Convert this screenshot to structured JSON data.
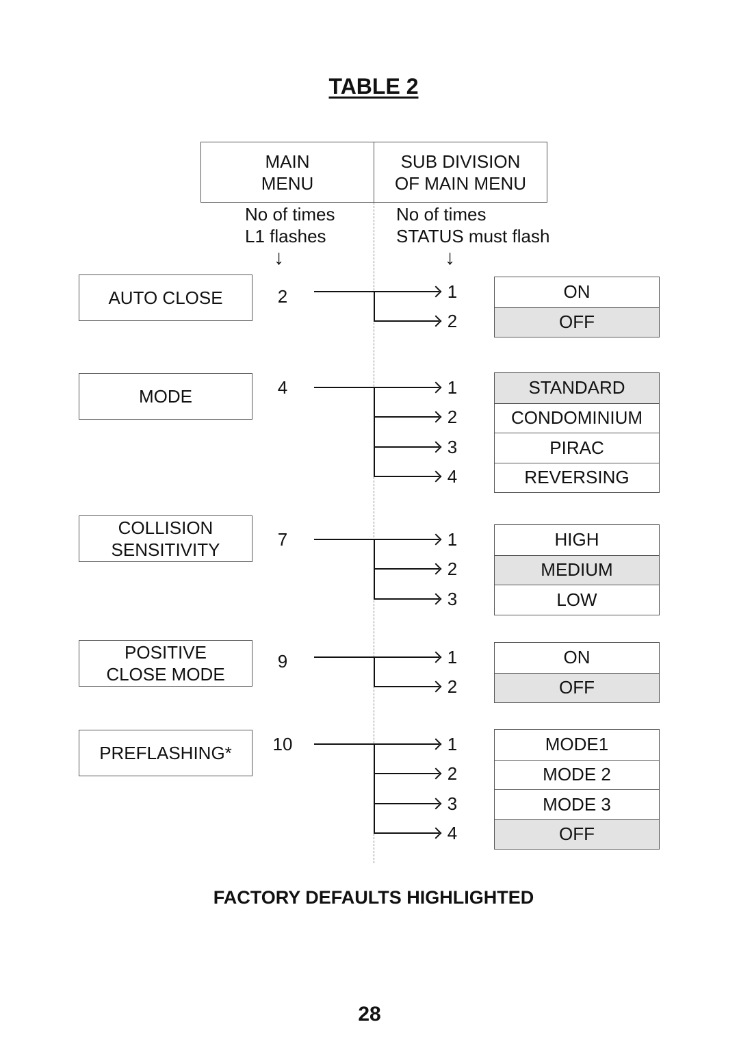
{
  "title": "TABLE 2",
  "header": {
    "main_menu": "MAIN\nMENU",
    "sub_division": "SUB DIVISION\nOF MAIN MENU",
    "main_note": "No of times\nL1 flashes",
    "sub_note": "No of times\nSTATUS must flash",
    "arrow_icon": "↓"
  },
  "groups": [
    {
      "name": "AUTO CLOSE",
      "flashes": "2",
      "options": [
        {
          "num": "1",
          "label": "ON",
          "default": false
        },
        {
          "num": "2",
          "label": "OFF",
          "default": true
        }
      ]
    },
    {
      "name": "MODE",
      "flashes": "4",
      "options": [
        {
          "num": "1",
          "label": "STANDARD",
          "default": true
        },
        {
          "num": "2",
          "label": "CONDOMINIUM",
          "default": false
        },
        {
          "num": "3",
          "label": "PIRAC",
          "default": false
        },
        {
          "num": "4",
          "label": "REVERSING",
          "default": false
        }
      ]
    },
    {
      "name": "COLLISION\nSENSITIVITY",
      "flashes": "7",
      "options": [
        {
          "num": "1",
          "label": "HIGH",
          "default": false
        },
        {
          "num": "2",
          "label": "MEDIUM",
          "default": true
        },
        {
          "num": "3",
          "label": "LOW",
          "default": false
        }
      ]
    },
    {
      "name": "POSITIVE\nCLOSE MODE",
      "flashes": "9",
      "options": [
        {
          "num": "1",
          "label": "ON",
          "default": false
        },
        {
          "num": "2",
          "label": "OFF",
          "default": true
        }
      ]
    },
    {
      "name": "PREFLASHING*",
      "flashes": "10",
      "options": [
        {
          "num": "1",
          "label": "MODE1",
          "default": false
        },
        {
          "num": "2",
          "label": "MODE 2",
          "default": false
        },
        {
          "num": "3",
          "label": "MODE 3",
          "default": false
        },
        {
          "num": "4",
          "label": "OFF",
          "default": true
        }
      ]
    }
  ],
  "colors": {
    "default_highlight": "#e3e3e3",
    "border": "#555555"
  },
  "footer": "FACTORY DEFAULTS HIGHLIGHTED",
  "page_number": "28"
}
